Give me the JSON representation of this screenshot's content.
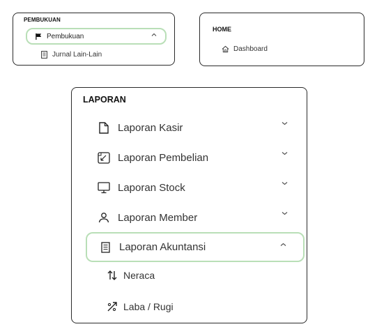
{
  "panel_pembukuan": {
    "title": "PEMBUKUAN",
    "active_item": {
      "label": "Pembukuan",
      "icon": "flag-icon"
    },
    "sub_items": [
      {
        "label": "Jurnal Lain-Lain",
        "icon": "document-icon"
      }
    ]
  },
  "panel_home": {
    "title": "HOME",
    "items": [
      {
        "label": "Dashboard",
        "icon": "home-icon"
      }
    ]
  },
  "panel_laporan": {
    "title": "LAPORAN",
    "items": [
      {
        "label": "Laporan Kasir",
        "icon": "file-icon"
      },
      {
        "label": "Laporan Pembelian",
        "icon": "receipt-icon"
      },
      {
        "label": "Laporan Stock",
        "icon": "monitor-icon"
      },
      {
        "label": "Laporan Member",
        "icon": "user-icon"
      },
      {
        "label": "Laporan Akuntansi",
        "icon": "ledger-icon"
      }
    ],
    "sub_items": [
      {
        "label": "Neraca",
        "icon": "up-down-arrows-icon"
      },
      {
        "label": "Laba / Rugi",
        "icon": "percent-arrow-icon"
      }
    ]
  },
  "colors": {
    "active_border": "#b9dfb7",
    "panel_border": "#2a2a2a"
  }
}
